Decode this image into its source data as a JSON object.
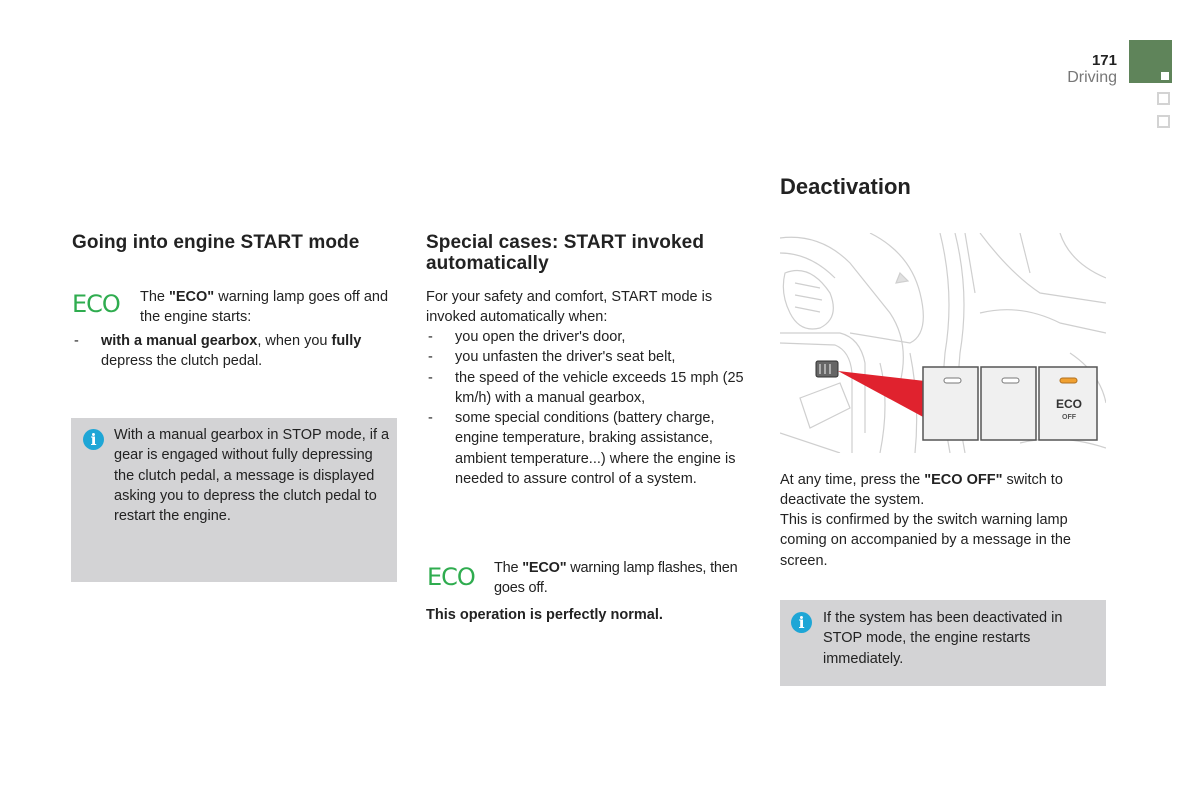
{
  "header": {
    "page_number": "171",
    "section": "Driving",
    "section_tabs": [
      {
        "state": "active",
        "color": "#5f845a"
      },
      {
        "state": "inactive"
      },
      {
        "state": "inactive"
      }
    ]
  },
  "col1": {
    "heading": "Going into engine START mode",
    "eco_icon_label": "ECO",
    "eco_text": {
      "pre": "The ",
      "bold": "\"ECO\"",
      "post": " warning lamp goes off and the engine starts:"
    },
    "bullet": {
      "bold1": "with a manual gearbox",
      "mid": ", when you ",
      "bold2": "fully",
      "post": " depress the clutch pedal."
    },
    "note": "With a manual gearbox in STOP mode, if a gear is engaged without fully depressing the clutch pedal, a message is displayed asking you to depress the clutch pedal to restart the engine."
  },
  "col2": {
    "heading_line1": "Special cases: START invoked",
    "heading_line2": "automatically",
    "intro": "For your safety and comfort, START mode is invoked automatically when:",
    "bullets": [
      "you open the driver's door,",
      "you unfasten the driver's seat belt,",
      "the speed of the vehicle exceeds 15 mph (25 km/h) with a manual gearbox,",
      "some special conditions (battery charge, engine temperature, braking assistance, ambient temperature...) where the engine is needed to assure control of a system."
    ],
    "eco_icon_label": "ECO",
    "eco_text": {
      "pre": "The ",
      "bold": "\"ECO\"",
      "post": " warning lamp flashes, then goes off."
    },
    "normal_note": "This operation is perfectly normal."
  },
  "col3": {
    "heading": "Deactivation",
    "illustration": {
      "switch_labels": {
        "eco": "ECO",
        "off": "OFF"
      },
      "led_color_eco": "#f0a030",
      "pointer_color": "#e0222e"
    },
    "text": {
      "pre": "At any time, press the ",
      "bold": "\"ECO OFF\"",
      "post": " switch to deactivate the system."
    },
    "text2": "This is confirmed by the switch warning lamp coming on accompanied by a message in the screen.",
    "note": "If the system has been deactivated in STOP mode, the engine restarts immediately."
  },
  "colors": {
    "eco_green": "#2fac4f",
    "info_blue": "#1ea6d6",
    "note_bg": "#d3d3d5",
    "tab_green": "#5f845a"
  }
}
